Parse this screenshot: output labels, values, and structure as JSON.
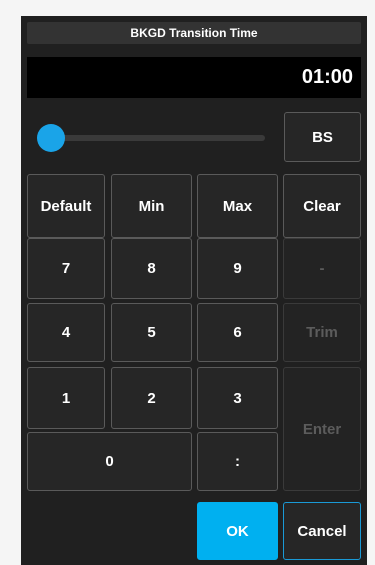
{
  "dialog": {
    "title": "BKGD Transition Time",
    "display_value": "01:00",
    "slider_level": 0.0
  },
  "keys": {
    "bs": "BS",
    "default": "Default",
    "min": "Min",
    "max": "Max",
    "clear": "Clear",
    "seven": "7",
    "eight": "8",
    "nine": "9",
    "minus": "-",
    "four": "4",
    "five": "5",
    "six": "6",
    "trim": "Trim",
    "one": "1",
    "two": "2",
    "three": "3",
    "enter": "Enter",
    "zero": "0",
    "colon": ":"
  },
  "footer": {
    "ok": "OK",
    "cancel": "Cancel"
  },
  "colors": {
    "accent": "#00b0f0",
    "slider": "#1aa4e8",
    "background": "#202020"
  }
}
